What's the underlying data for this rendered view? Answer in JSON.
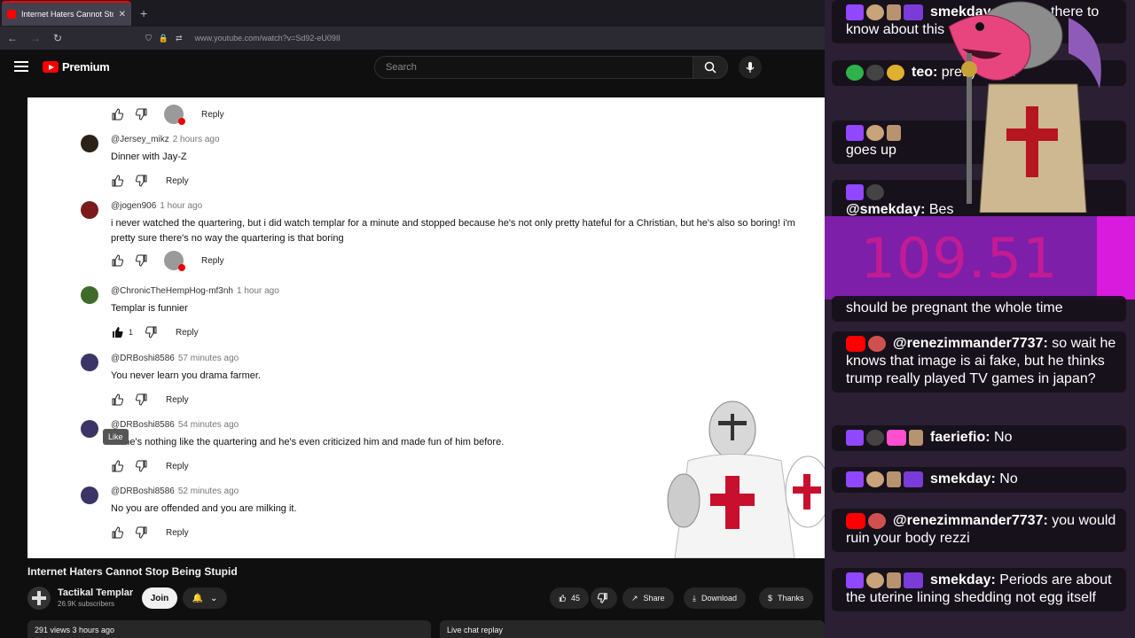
{
  "browser": {
    "tab_title": "Internet Haters Cannot Stop Be",
    "tab_close": "✕",
    "new_tab": "+",
    "url": "www.youtube.com/watch?v=Sd92-eU09II"
  },
  "youtube": {
    "logo_text": "Premium",
    "search_placeholder": "Search"
  },
  "comments": [
    {
      "handle": "",
      "time": "",
      "body": "",
      "likes": "",
      "reply": "Reply"
    },
    {
      "handle": "@Jersey_mikz",
      "time": "2 hours ago",
      "body": "Dinner with  Jay-Z",
      "likes": "",
      "reply": "Reply"
    },
    {
      "handle": "@jogen906",
      "time": "1 hour ago",
      "body": "i never watched the quartering, but i did watch templar for a minute and stopped because he's not only pretty hateful for a Christian, but he's also so boring! i'm pretty sure there's no way the quartering is that boring",
      "likes": "",
      "reply": "Reply"
    },
    {
      "handle": "@ChronicTheHempHog-mf3nh",
      "time": "1 hour ago",
      "body": "Templar is funnier",
      "likes": "1",
      "reply": "Reply"
    },
    {
      "handle": "@DRBoshi8586",
      "time": "57 minutes ago",
      "body": "You never learn you drama farmer.",
      "likes": "",
      "reply": "Reply"
    },
    {
      "handle": "@DRBoshi8586",
      "time": "54 minutes ago",
      "body": "no he's nothing like the quartering and he's even criticized him and made fun of him before.",
      "likes": "",
      "reply": "Reply"
    },
    {
      "handle": "@DRBoshi8586",
      "time": "52 minutes ago",
      "body": "No you are offended and you are milking it.",
      "likes": "",
      "reply": "Reply"
    }
  ],
  "tooltip": "Like",
  "video": {
    "title": "Internet Haters Cannot Stop Being Stupid",
    "channel": "Tactikal Templar",
    "subscribers": "26.9K subscribers",
    "join": "Join",
    "likes": "45",
    "share": "Share",
    "download": "Download",
    "thanks": "Thanks",
    "views_time": "291 views  3 hours ago",
    "live_chat": "Live chat replay"
  },
  "overlay": {
    "counter": "109.51",
    "messages": [
      {
        "user": "smekday:",
        "text": "What is there to know about this"
      },
      {
        "user": "teo:",
        "text": "pretty much"
      },
      {
        "user": "",
        "text": "goes up"
      },
      {
        "user": "@smekday:",
        "text": "Bes"
      },
      {
        "user": "",
        "text": "should be pregnant the whole time"
      },
      {
        "user": "@renezimmander7737:",
        "text": "so wait he knows that image is ai fake, but he thinks trump really played TV games in japan?"
      },
      {
        "user": "faeriefio:",
        "text": "No"
      },
      {
        "user": "smekday:",
        "text": "No"
      },
      {
        "user": "@renezimmander7737:",
        "text": "you would ruin your body rezzi"
      },
      {
        "user": "smekday:",
        "text": "Periods are about the uterine lining shedding not egg itself"
      }
    ]
  },
  "colors": {
    "accent_red": "#ff0000",
    "twitch_purple": "#9146ff",
    "counter_bg": "#7d1fa8"
  }
}
